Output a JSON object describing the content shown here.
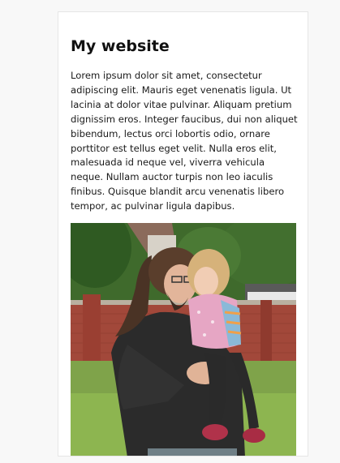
{
  "article": {
    "title": "My website",
    "paragraph": "Lorem ipsum dolor sit amet, consectetur adipiscing elit. Mauris eget venenatis ligula. Ut lacinia at dolor vitae pulvinar. Aliquam pretium dignissim eros. Integer faucibus, dui non aliquet bibendum, lectus orci lobortis odio, ornare porttitor est tellus eget velit. Nulla eros elit, malesuada id neque vel, viverra vehicula neque. Nullam auctor turpis non leo iaculis finibus. Quisque blandit arcu venenatis libero tempor, ac pulvinar ligula dapibus."
  },
  "colors": {
    "background": "#f8f8f8",
    "card": "#ffffff",
    "text": "#1a1a1a"
  }
}
